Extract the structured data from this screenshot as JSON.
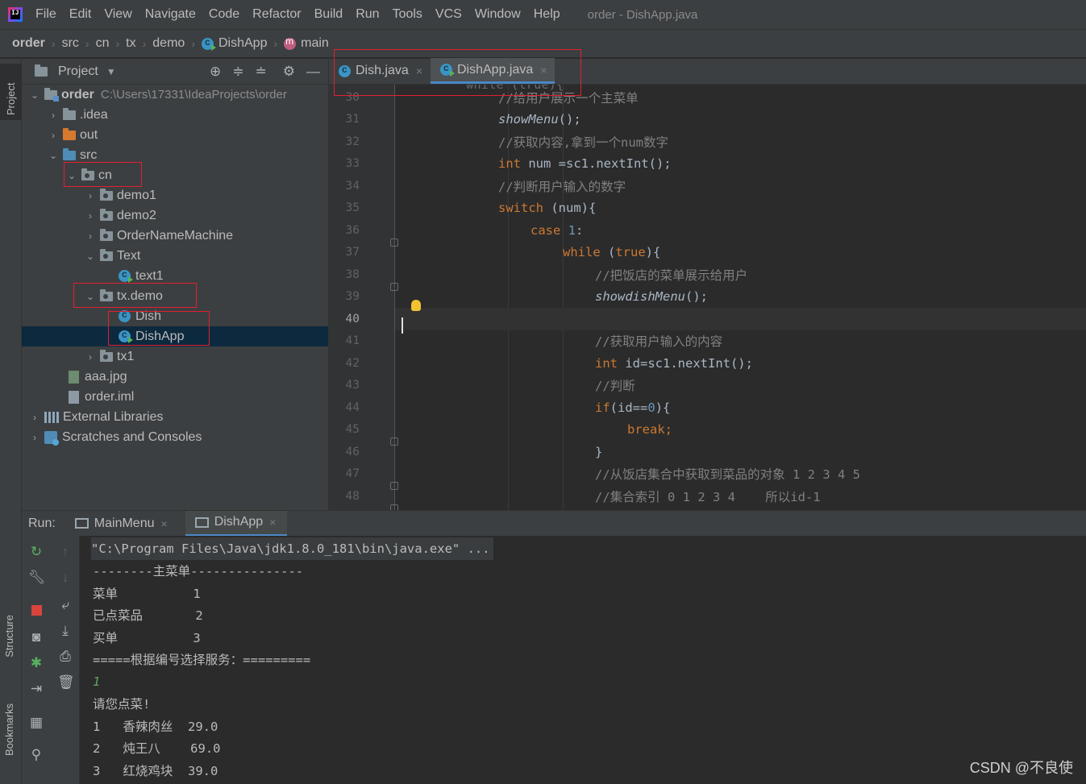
{
  "menu": {
    "items": [
      "File",
      "Edit",
      "View",
      "Navigate",
      "Code",
      "Refactor",
      "Build",
      "Run",
      "Tools",
      "VCS",
      "Window",
      "Help"
    ],
    "window_title": "order - DishApp.java"
  },
  "breadcrumb": [
    "order",
    "src",
    "cn",
    "tx",
    "demo",
    "DishApp",
    "main"
  ],
  "left_strip": {
    "project": "Project",
    "structure": "Structure",
    "bookmarks": "Bookmarks"
  },
  "project_panel": {
    "title": "Project",
    "root_name": "order",
    "root_path": "C:\\Users\\17331\\IdeaProjects\\order",
    "nodes": {
      "idea": ".idea",
      "out": "out",
      "src": "src",
      "cn": "cn",
      "demo1": "demo1",
      "demo2": "demo2",
      "ordernamemachine": "OrderNameMachine",
      "text": "Text",
      "text1": "text1",
      "txdemo": "tx.demo",
      "dish": "Dish",
      "dishapp": "DishApp",
      "tx1": "tx1",
      "aaajpg": "aaa.jpg",
      "orderiml": "order.iml",
      "extlibs": "External Libraries",
      "scratches": "Scratches and Consoles"
    }
  },
  "editor": {
    "tabs": [
      {
        "label": "Dish.java",
        "active": false
      },
      {
        "label": "DishApp.java",
        "active": true
      }
    ],
    "line_numbers": [
      "30",
      "31",
      "32",
      "33",
      "34",
      "35",
      "36",
      "37",
      "38",
      "39",
      "40",
      "41",
      "42",
      "43",
      "44",
      "45",
      "46",
      "47",
      "48"
    ],
    "current_line": "40",
    "partial_top_line": "while (true){",
    "code": {
      "l30": "//给用户展示一个主菜单",
      "l31a": "showMenu",
      "l31b": "();",
      "l32": "//获取内容,拿到一个num数字",
      "l33a": "int",
      "l33b": " num =sc1.nextInt();",
      "l34": "//判断用户输入的数字",
      "l35a": "switch",
      "l35b": " (num){",
      "l36a": "case ",
      "l36b": "1",
      "l36c": ":",
      "l37a": "while",
      "l37b": " (",
      "l37c": "true",
      "l37d": "){",
      "l38": "//把饭店的菜单展示给用户",
      "l39a": "showdishMenu",
      "l39b": "();",
      "l41": "//获取用户输入的内容",
      "l42a": "int",
      "l42b": " id=sc1.nextInt();",
      "l43": "//判断",
      "l44a": "if",
      "l44b": "(id==",
      "l44c": "0",
      "l44d": "){",
      "l45a": "break",
      "l45b": ";",
      "l46": "}",
      "l47": "//从饭店集合中获取到菜品的对象 1 2 3 4 5",
      "l48": "//集合索引 0 1 2 3 4    所以id-1"
    }
  },
  "run_panel": {
    "label": "Run:",
    "tabs": [
      {
        "label": "MainMenu",
        "active": false
      },
      {
        "label": "DishApp",
        "active": true
      }
    ],
    "console": [
      "\"C:\\Program Files\\Java\\jdk1.8.0_181\\bin\\java.exe\" ...",
      "--------主菜单---------------",
      "菜单          1",
      "已点菜品       2",
      "买单          3",
      "=====根据编号选择服务：=========",
      "1",
      "请您点菜!",
      "1   香辣肉丝  29.0",
      "2   炖王八    69.0",
      "3   红烧鸡块  39.0"
    ]
  },
  "watermark": "CSDN @不良使",
  "colors": {
    "highlight_box": "#e02030",
    "selection": "#0d293e",
    "keyword": "#cc7832",
    "comment": "#808080",
    "number": "#6897bb"
  }
}
